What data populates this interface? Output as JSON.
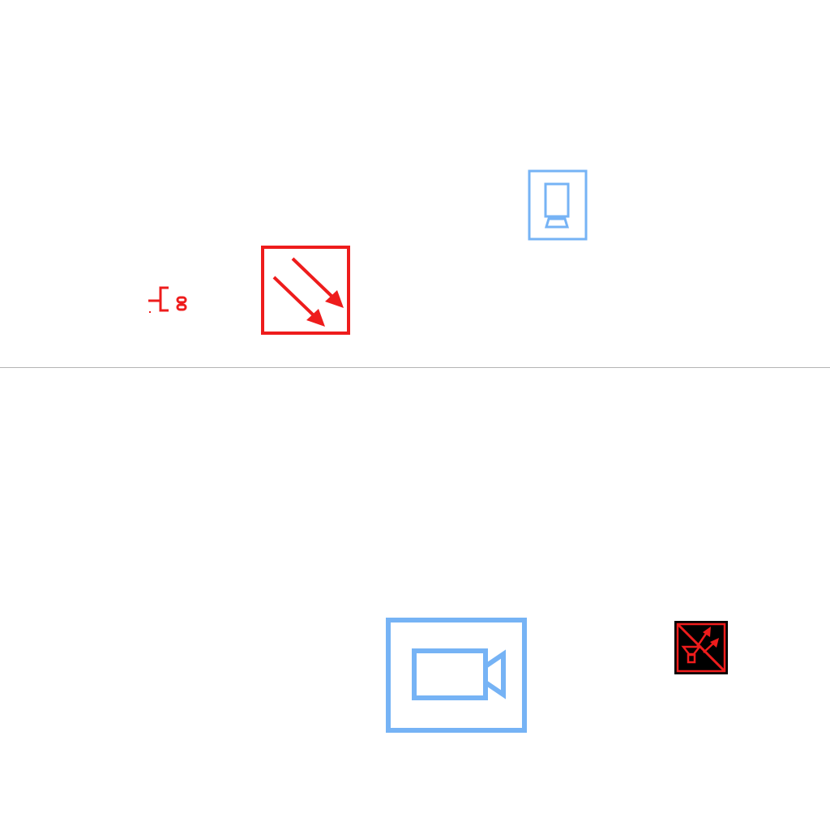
{
  "canvas": {
    "background": "#ffffff",
    "divider_color": "#b4b4b4"
  },
  "colors": {
    "red": "#ee1c1c",
    "blue": "#76b3f5",
    "black": "#000000"
  },
  "symbols": [
    {
      "icon": "feeder-branch-icon",
      "color": "red",
      "region": "top"
    },
    {
      "icon": "diagonal-double-arrow-icon",
      "color": "red",
      "region": "top"
    },
    {
      "icon": "display-stand-icon",
      "color": "blue",
      "region": "top"
    },
    {
      "icon": "video-camera-icon",
      "color": "blue",
      "region": "bottom"
    },
    {
      "icon": "crossed-light-fixture-icon",
      "color": "red",
      "background": "black",
      "region": "bottom"
    }
  ]
}
